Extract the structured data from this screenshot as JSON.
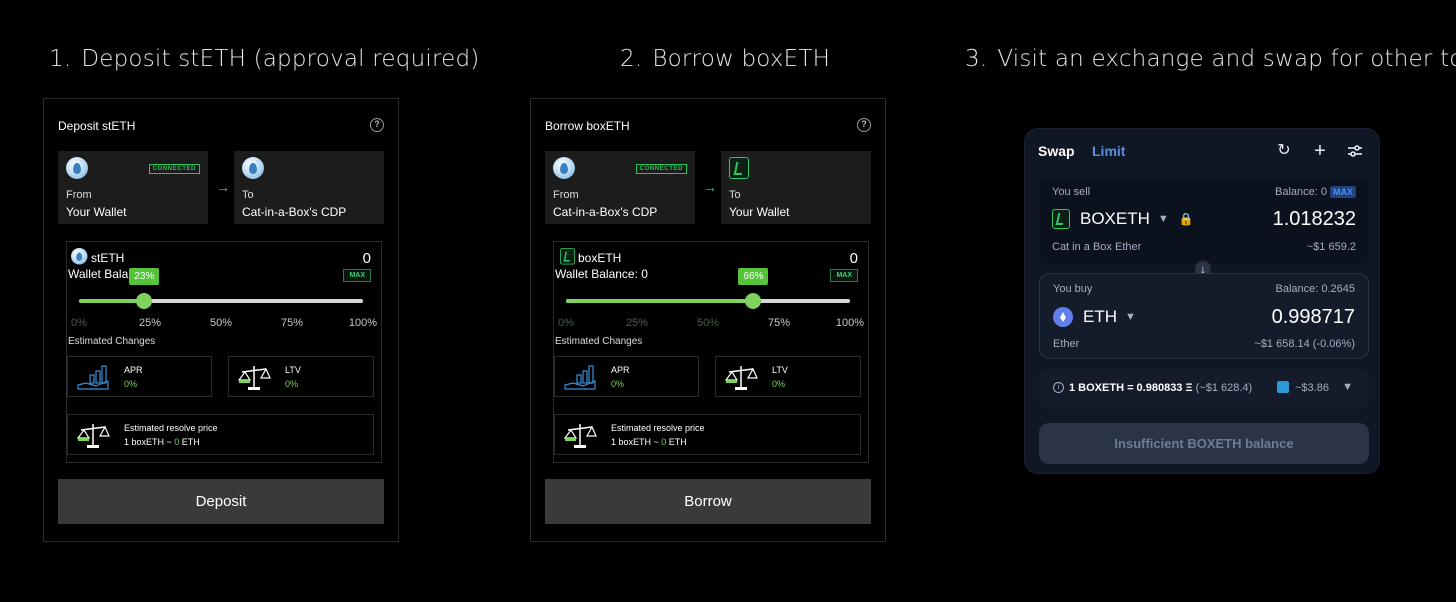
{
  "steps": [
    {
      "num": "1.",
      "title": "Deposit stETH (approval required)"
    },
    {
      "num": "2.",
      "title": "Borrow boxETH"
    },
    {
      "num": "3.",
      "title": "Visit an exchange and swap for other tokens"
    }
  ],
  "deposit": {
    "header": "Deposit stETH",
    "from": {
      "role": "From",
      "place": "Your Wallet",
      "badge": "CONNECTED"
    },
    "to": {
      "role": "To",
      "place": "Cat-in-a-Box's CDP"
    },
    "token": "stETH",
    "balance_label": "Wallet Balar",
    "amount": "0",
    "max": "MAX",
    "slider_percent": 23,
    "slider_tip": "23%",
    "ticks": [
      "0%",
      "25%",
      "50%",
      "75%",
      "100%"
    ],
    "estimated_label": "Estimated Changes",
    "apr": {
      "title": "APR",
      "value": "0%"
    },
    "ltv": {
      "title": "LTV",
      "value": "0%"
    },
    "resolve": {
      "title": "Estimated resolve price",
      "prefix": "1 boxETH ~ ",
      "value": "0",
      "suffix": " ETH"
    },
    "button": "Deposit"
  },
  "borrow": {
    "header": "Borrow boxETH",
    "from": {
      "role": "From",
      "place": "Cat-in-a-Box's CDP",
      "badge": "CONNECTED"
    },
    "to": {
      "role": "To",
      "place": "Your Wallet"
    },
    "token": "boxETH",
    "balance_label": "Wallet Balance: 0",
    "amount": "0",
    "max": "MAX",
    "slider_percent": 66,
    "slider_tip": "66%",
    "ticks": [
      "0%",
      "25%",
      "50%",
      "75%",
      "100%"
    ],
    "estimated_label": "Estimated Changes",
    "apr": {
      "title": "APR",
      "value": "0%"
    },
    "ltv": {
      "title": "LTV",
      "value": "0%"
    },
    "resolve": {
      "title": "Estimated resolve price",
      "prefix": "1 boxETH ~ ",
      "value": "0",
      "suffix": " ETH"
    },
    "button": "Borrow"
  },
  "swap": {
    "tabs": [
      "Swap",
      "Limit"
    ],
    "sell": {
      "label": "You sell",
      "balance": "Balance: 0",
      "max": "MAX",
      "token": "BOXETH",
      "token_name": "Cat in a Box Ether",
      "amount": "1.018232",
      "usd": "~$1 659.2"
    },
    "buy": {
      "label": "You buy",
      "balance": "Balance: 0.2645",
      "token": "ETH",
      "token_name": "Ether",
      "amount": "0.998717",
      "usd": "~$1 658.14 (-0.06%)"
    },
    "rate": "1 BOXETH = 0.980833 Ξ",
    "rate_usd": "(~$1 628.4)",
    "gas": "~$3.86",
    "button": "Insufficient BOXETH balance"
  },
  "colors": {
    "accent_green": "#7fd25b",
    "connected": "#29c35a",
    "swap_bg": "#0f1624"
  }
}
